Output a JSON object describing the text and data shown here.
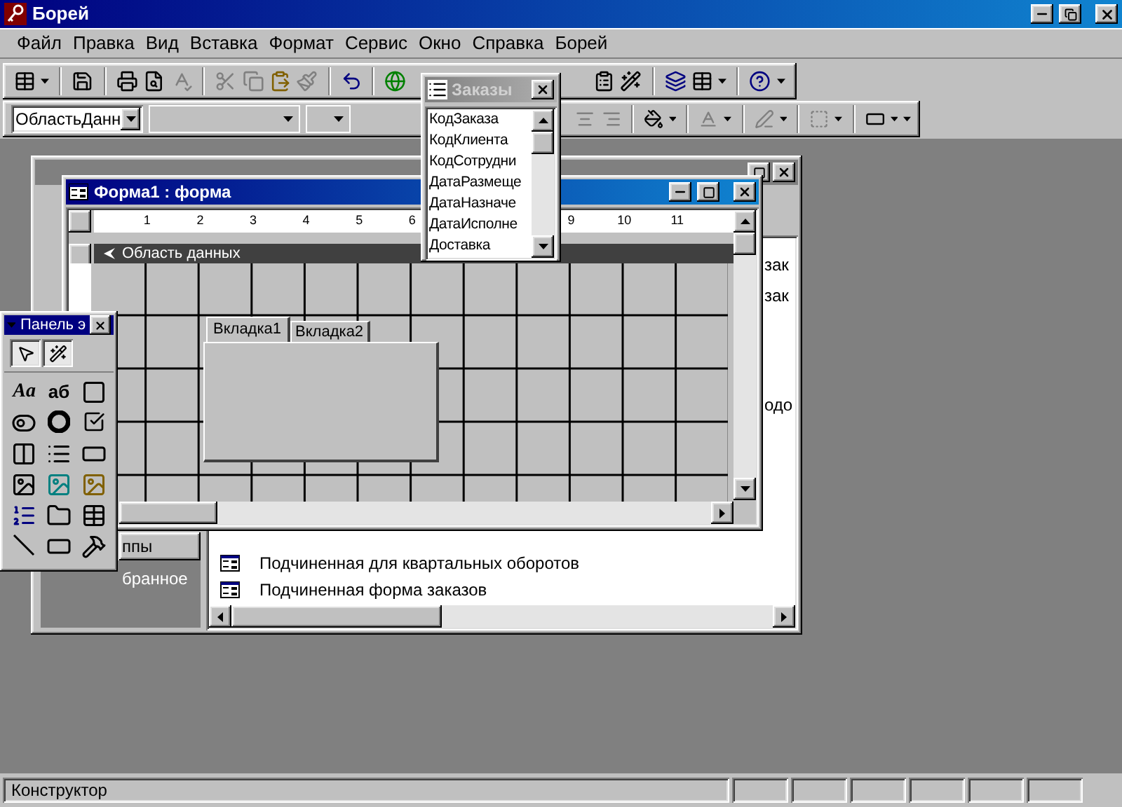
{
  "app": {
    "title": "Борей"
  },
  "menu": [
    {
      "label": "Файл"
    },
    {
      "label": "Правка"
    },
    {
      "label": "Вид"
    },
    {
      "label": "Вставка"
    },
    {
      "label": "Формат"
    },
    {
      "label": "Сервис"
    },
    {
      "label": "Окно"
    },
    {
      "label": "Справка"
    },
    {
      "label": "Борей"
    }
  ],
  "format_toolbar": {
    "object_combo": "ОбластьДанн"
  },
  "field_list": {
    "title": "Заказы",
    "fields": [
      "КодЗаказа",
      "КодКлиента",
      "КодСотрудни",
      "ДатаРазмеще",
      "ДатаНазначе",
      "ДатаИсполне",
      "Доставка"
    ]
  },
  "database_window": {
    "groups_button": "ппы",
    "favorites": "бранное",
    "object_fragments": [
      "зак",
      "зак",
      "одо"
    ],
    "objects": [
      "Подчиненная для квартальных оборотов",
      "Подчиненная форма заказов"
    ]
  },
  "form_window": {
    "title": "Форма1 : форма",
    "ruler": [
      "1",
      "2",
      "3",
      "4",
      "5",
      "6",
      "9",
      "10",
      "11"
    ],
    "section": "Область данных",
    "tabs": [
      {
        "label": "Вкладка1",
        "selected": true
      },
      {
        "label": "Вкладка2",
        "selected": false
      }
    ]
  },
  "toolbox": {
    "title": "Панель э",
    "label_tool": "Aa",
    "textbox_tool": "аб"
  },
  "status_bar": {
    "text": "Конструктор"
  }
}
